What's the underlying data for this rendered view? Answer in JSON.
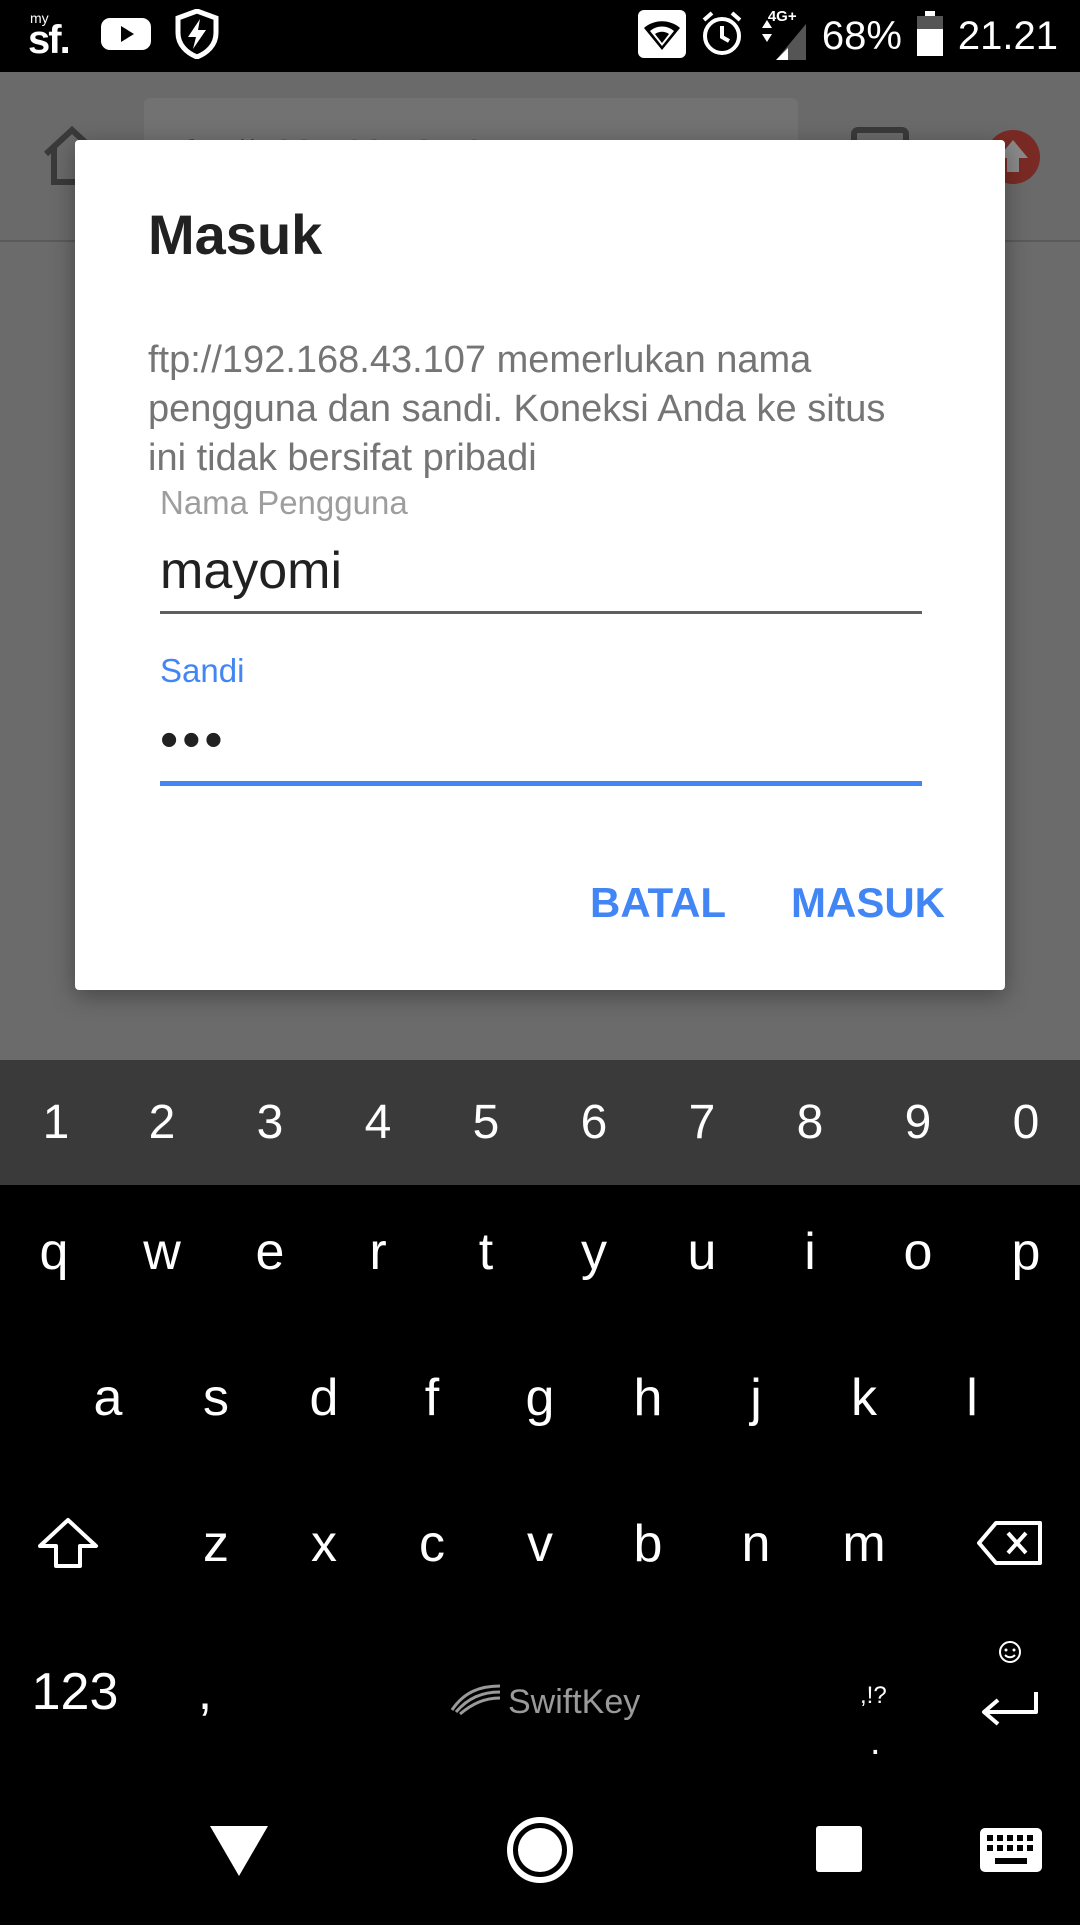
{
  "status_bar": {
    "carrier_top": "my",
    "carrier_main": "sf.",
    "battery": "68%",
    "time": "21.21",
    "network_tag": "4G+",
    "icons": [
      "youtube-icon",
      "shield-bolt-icon",
      "wifi-icon",
      "alarm-icon",
      "signal-icon",
      "battery-icon"
    ]
  },
  "browser": {
    "url": "ftp://192.168.43.107"
  },
  "dialog": {
    "title": "Masuk",
    "message": "ftp://192.168.43.107 memerlukan nama pengguna dan sandi. Koneksi Anda ke situs ini tidak bersifat pribadi",
    "username_label": "Nama Pengguna",
    "username_value": "mayomi",
    "password_label": "Sandi",
    "password_value": "•••",
    "cancel_label": "BATAL",
    "submit_label": "MASUK",
    "accent_color": "#4285f4"
  },
  "keyboard": {
    "numbers": [
      "1",
      "2",
      "3",
      "4",
      "5",
      "6",
      "7",
      "8",
      "9",
      "0"
    ],
    "row1": [
      "q",
      "w",
      "e",
      "r",
      "t",
      "y",
      "u",
      "i",
      "o",
      "p"
    ],
    "row2": [
      "a",
      "s",
      "d",
      "f",
      "g",
      "h",
      "j",
      "k",
      "l"
    ],
    "row3": [
      "z",
      "x",
      "c",
      "v",
      "b",
      "n",
      "m"
    ],
    "mode_key": "123",
    "comma_key": ",",
    "punct_top": ",!?",
    "punct_bottom": ".",
    "brand": "SwiftKey"
  }
}
